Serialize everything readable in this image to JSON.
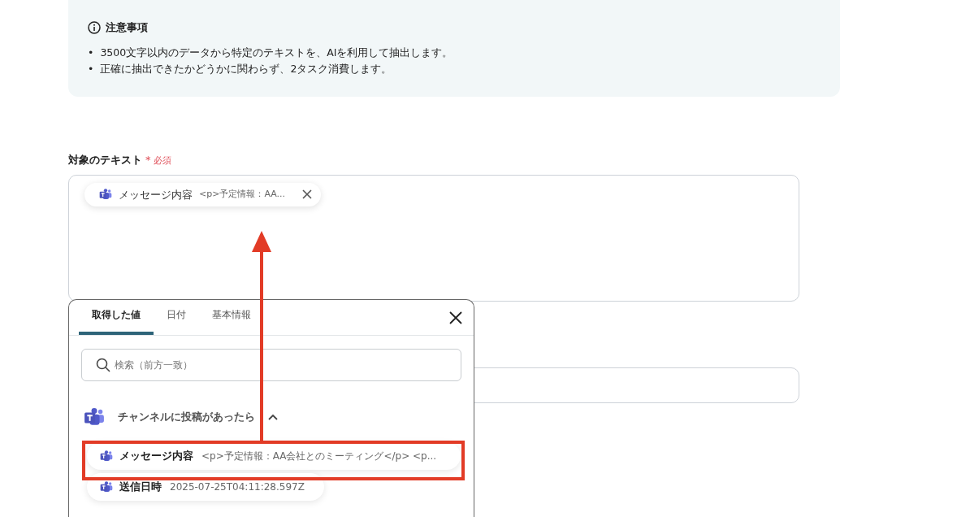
{
  "notice": {
    "title": "注意事項",
    "items": [
      {
        "bullet": "•",
        "text": "3500文字以内のデータから特定のテキストを、AIを利用して抽出します。"
      },
      {
        "bullet": "•",
        "text": "正確に抽出できたかどうかに関わらず、2タスク消費します。"
      }
    ]
  },
  "field": {
    "label": "対象のテキスト",
    "required_mark": "*",
    "required_text": "必須",
    "chips": [
      {
        "name": "メッセージ内容",
        "value": "<p>予定情報：AA..."
      }
    ]
  },
  "popup": {
    "tabs": [
      {
        "label": "取得した値",
        "selected": true
      },
      {
        "label": "日付",
        "selected": false
      },
      {
        "label": "基本情報",
        "selected": false
      }
    ],
    "search": {
      "placeholder": "検索（前方一致）"
    },
    "group": {
      "title": "チャンネルに投稿があったら",
      "expanded": true,
      "items": [
        {
          "name": "メッセージ内容",
          "value": "<p>予定情報：AA会社とのミーティング</p> <p...",
          "highlighted": true
        },
        {
          "name": "送信日時",
          "value": "2025-07-25T04:11:28.597Z",
          "highlighted": false
        }
      ]
    }
  }
}
